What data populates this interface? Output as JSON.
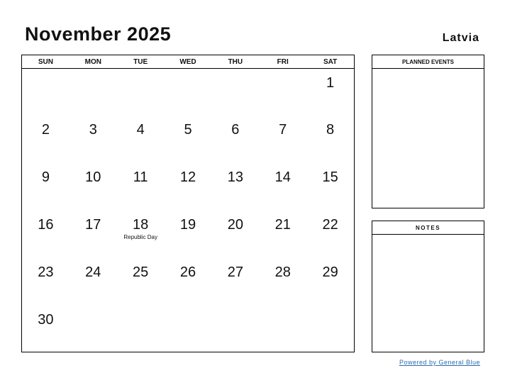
{
  "header": {
    "title": "November 2025",
    "country": "Latvia"
  },
  "calendar": {
    "weekdays": [
      "SUN",
      "MON",
      "TUE",
      "WED",
      "THU",
      "FRI",
      "SAT"
    ],
    "weeks": [
      [
        {
          "day": ""
        },
        {
          "day": ""
        },
        {
          "day": ""
        },
        {
          "day": ""
        },
        {
          "day": ""
        },
        {
          "day": ""
        },
        {
          "day": "1"
        }
      ],
      [
        {
          "day": "2"
        },
        {
          "day": "3"
        },
        {
          "day": "4"
        },
        {
          "day": "5"
        },
        {
          "day": "6"
        },
        {
          "day": "7"
        },
        {
          "day": "8"
        }
      ],
      [
        {
          "day": "9"
        },
        {
          "day": "10"
        },
        {
          "day": "11"
        },
        {
          "day": "12"
        },
        {
          "day": "13"
        },
        {
          "day": "14"
        },
        {
          "day": "15"
        }
      ],
      [
        {
          "day": "16"
        },
        {
          "day": "17"
        },
        {
          "day": "18",
          "holiday": "Republic Day"
        },
        {
          "day": "19"
        },
        {
          "day": "20"
        },
        {
          "day": "21"
        },
        {
          "day": "22"
        }
      ],
      [
        {
          "day": "23"
        },
        {
          "day": "24"
        },
        {
          "day": "25"
        },
        {
          "day": "26"
        },
        {
          "day": "27"
        },
        {
          "day": "28"
        },
        {
          "day": "29"
        }
      ],
      [
        {
          "day": "30"
        },
        {
          "day": ""
        },
        {
          "day": ""
        },
        {
          "day": ""
        },
        {
          "day": ""
        },
        {
          "day": ""
        },
        {
          "day": ""
        }
      ]
    ]
  },
  "sidebar": {
    "planned_events_label": "PLANNED EVENTS",
    "notes_label": "NOTES"
  },
  "footer": {
    "powered_by": "Powered by General Blue"
  }
}
